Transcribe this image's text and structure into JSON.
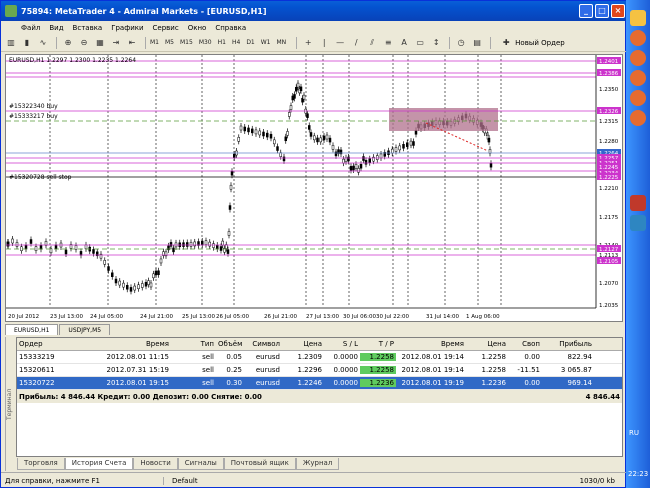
{
  "window": {
    "title": "75894: MetaTrader 4 - Admiral Markets - [EURUSD,H1]"
  },
  "menu": [
    "Файл",
    "Вид",
    "Вставка",
    "Графики",
    "Сервис",
    "Окно",
    "Справка"
  ],
  "toolbar": {
    "timeframes": [
      "M1",
      "M5",
      "M15",
      "M30",
      "H1",
      "H4",
      "D1",
      "W1",
      "MN"
    ],
    "new_order": "Новый Ордер"
  },
  "chart": {
    "header": "EURUSD,H1  1.2297 1.2300 1.2235 1.2264",
    "order_labels": [
      "#15322340 buy",
      "#15333217 buy",
      "#15320728 sell stop"
    ],
    "price_scale": [
      "1.2401",
      "1.2386",
      "1.2350",
      "1.2326",
      "1.2315",
      "1.2280",
      "1.2264",
      "1.2257",
      "1.2251",
      "1.2245",
      "1.2234",
      "1.2225",
      "1.2210",
      "1.2175",
      "1.2140",
      "1.2127",
      "1.2113",
      "1.2105",
      "1.2070",
      "1.2035"
    ],
    "time_scale": [
      "20 Jul 2012",
      "23 Jul 13:00",
      "24 Jul 05:00",
      "24 Jul 21:00",
      "25 Jul 13:00",
      "26 Jul 05:00",
      "26 Jul 21:00",
      "27 Jul 13:00",
      "30 Jul 06:00",
      "30 Jul 22:00",
      "31 Jul 14:00",
      "1 Aug 06:00"
    ],
    "colors": {
      "order_line": "#CC33CC",
      "grid": "#000000",
      "rect": "#B0708C",
      "current": "#3366CC"
    }
  },
  "chart_tabs": [
    "EURUSD,H1",
    "USDJPY,M5"
  ],
  "terminal": {
    "headers": [
      "Ордер",
      "Время",
      "Тип",
      "Объём",
      "Символ",
      "Цена",
      "S / L",
      "T / P",
      "Время",
      "Цена",
      "Своп",
      "Прибыль"
    ],
    "rows": [
      [
        "15333219",
        "2012.08.01 11:15",
        "sell",
        "0.05",
        "eurusd",
        "1.2309",
        "0.0000",
        "1.2258",
        "2012.08.01 19:14",
        "1.2258",
        "0.00",
        "822.94"
      ],
      [
        "15320611",
        "2012.07.31 15:19",
        "sell",
        "0.25",
        "eurusd",
        "1.2296",
        "0.0000",
        "1.2258",
        "2012.08.01 19:14",
        "1.2258",
        "-11.51",
        "3 065.87"
      ],
      [
        "15320722",
        "2012.08.01 19:15",
        "sell",
        "0.30",
        "eurusd",
        "1.2246",
        "0.0000",
        "1.2236",
        "2012.08.01 19:19",
        "1.2236",
        "0.00",
        "969.14"
      ]
    ],
    "summary": "Прибыль: 4 846.44  Кредит: 0.00  Депозит: 0.00  Снятие: 0.00",
    "summary_total": "4 846.44",
    "side_label": "Терминал"
  },
  "bottom_tabs": [
    "Торговля",
    "История Счета",
    "Новости",
    "Сигналы",
    "Почтовый ящик",
    "Журнал"
  ],
  "status": {
    "help": "Для справки, нажмите F1",
    "profile": "Default",
    "traffic": "1030/0 kb"
  },
  "taskbar": {
    "lang": "RU",
    "time": "22:23"
  }
}
